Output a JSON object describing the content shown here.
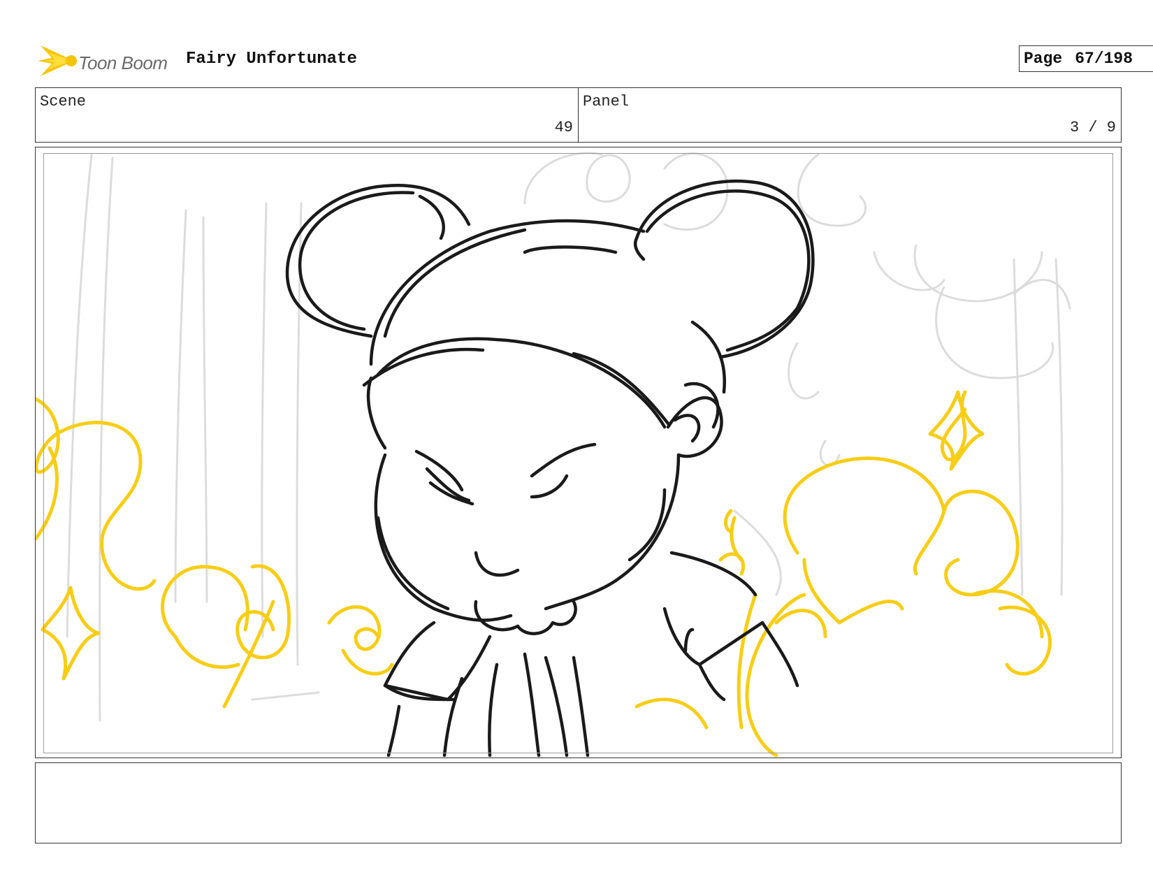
{
  "header": {
    "logo_text": "Toon Boom",
    "project_title": "Fairy Unfortunate",
    "page_label": "Page",
    "page_value": "67/198"
  },
  "scene": {
    "label": "Scene",
    "value": "49"
  },
  "panel": {
    "label": "Panel",
    "value": "3 / 9"
  },
  "drawing": {
    "icon": "storyboard-sketch",
    "colors": {
      "ink": "#1a1a1a",
      "magic": "#f7cd16",
      "background_sketch": "#d7d7d7"
    }
  },
  "notes": {
    "text": ""
  },
  "colors": {
    "logo_yellow": "#f5c400",
    "frame_border": "#333333",
    "safe_area": "#9a9a9a"
  }
}
